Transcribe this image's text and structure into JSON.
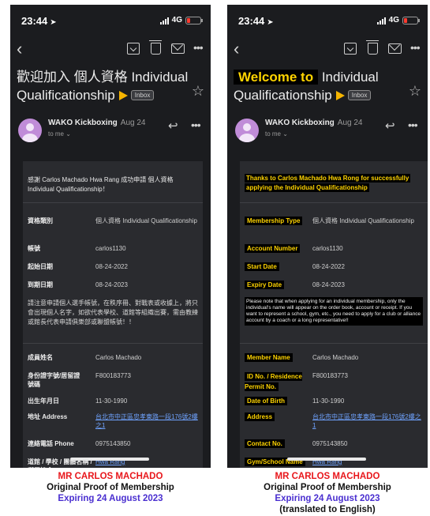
{
  "status": {
    "time": "23:44",
    "network": "4G"
  },
  "left": {
    "subject": {
      "text": "歡迎加入 個人資格 Individual Qualificationship"
    },
    "inbox_label": "Inbox",
    "sender": {
      "name": "WAKO Kickboxing",
      "date": "Aug 24",
      "to": "to me ⌄"
    },
    "intro": "感謝 Carlos Machado Hwa Rang 成功申請 個人資格 Individual Qualificationship！",
    "membership_type": {
      "label": "資格類別",
      "value": "個人資格 Individual Qualificationship"
    },
    "account_number": {
      "label": "帳號",
      "value": "carlos1130"
    },
    "start_date": {
      "label": "起始日期",
      "value": "08-24-2022"
    },
    "expiry_date": {
      "label": "到期日期",
      "value": "08-24-2023"
    },
    "note": "請注意申請個人選手帳號，在秩序冊、對戰表或收據上，將只會出現個人名字，如欲代表學校、道館等組織出賽，需由教練或館長代表申請俱樂部或聯盟帳號！！",
    "member_name": {
      "label": "成員姓名",
      "value": "Carlos Machado"
    },
    "id_no": {
      "label": "身份證字號/居留證號碼",
      "value": "F800183773"
    },
    "dob": {
      "label": "出生年月日",
      "value": "11-30-1990"
    },
    "address": {
      "label": "地址 Address",
      "value": "台北市中正區忠孝東路一段176號2樓之1"
    },
    "contact": {
      "label": "連絡電話 Phone",
      "value": "0975143850"
    },
    "gym": {
      "label": "道館 / 學校 / 團體名稱 / 所屬協會",
      "value": "Hwa Rang"
    }
  },
  "right": {
    "subject_highlight": "Welcome to",
    "subject_rest": "Individual Qualificationship",
    "inbox_label": "Inbox",
    "sender": {
      "name": "WAKO Kickboxing",
      "date": "Aug 24",
      "to": "to me ⌄"
    },
    "intro": "Thanks to Carlos Machado Hwa Rong for successfully applying the Individual Qualificationship",
    "membership_type": {
      "label": "Membership Type",
      "value": "個人資格 Individual Qualificationship"
    },
    "account_number": {
      "label": "Account Number",
      "value": "carlos1130"
    },
    "start_date": {
      "label": "Start Date",
      "value": "08-24-2022"
    },
    "expiry_date": {
      "label": "Expiry Date",
      "value": "08-24-2023"
    },
    "note": "Please note that when applying for an individual membership, only the individual's name will appear on the order book, account or receipt. If you want to represent a school, gym, etc., you need to apply for a club or alliance account by a coach or a long representative!!",
    "member_name": {
      "label": "Member Name",
      "value": "Carlos Machado"
    },
    "id_no": {
      "label": "ID No. / Residence Permit No.",
      "value": "F800183773"
    },
    "dob": {
      "label": "Date of Birth",
      "value": "11-30-1990"
    },
    "address": {
      "label": "Address",
      "value": "台北市中正區忠孝東路一段176號2樓之1"
    },
    "contact": {
      "label": "Contact No.",
      "value": "0975143850"
    },
    "gym": {
      "label": "Gym/School Name",
      "value": "Hwa Rang"
    }
  },
  "captions": {
    "left": {
      "name": "MR CARLOS MACHADO",
      "line2": "Original Proof of Membership",
      "line3": "Expiring 24 August 2023"
    },
    "right": {
      "name": "MR CARLOS MACHADO",
      "line2": "Original Proof of Membership",
      "line3": "Expiring 24 August 2023",
      "line4": "(translated to English)"
    }
  },
  "colors": {
    "phone_bg": "#1b1c1f",
    "card_bg": "#2a2b2f",
    "highlight": "#ffd400",
    "caption_red": "#e8161b",
    "caption_blue": "#4a2fd0",
    "link": "#6fa3ff"
  }
}
